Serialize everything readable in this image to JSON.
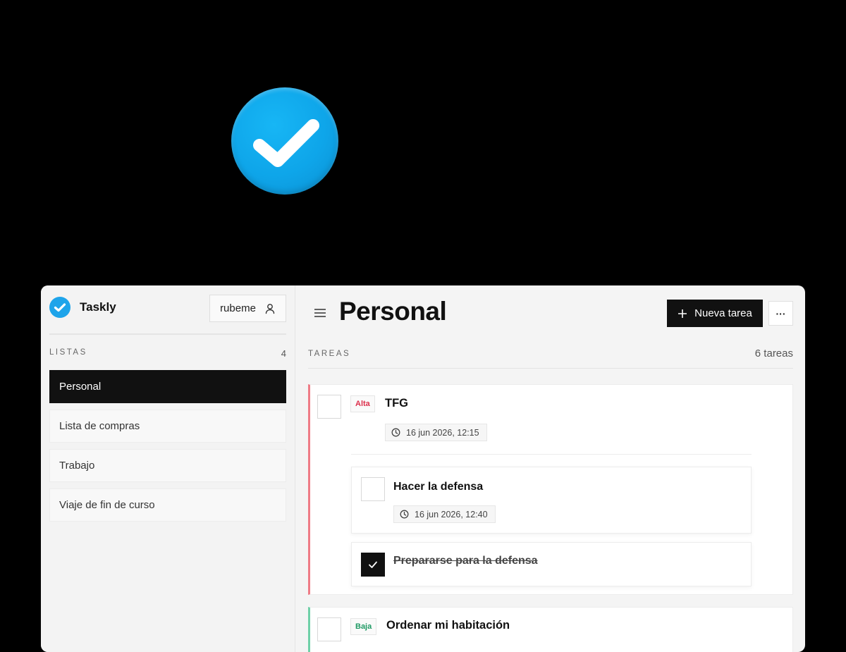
{
  "app": {
    "name": "Taskly",
    "brand_color": "#1ea4ea"
  },
  "user": {
    "name": "rubeme",
    "icon": "user-icon"
  },
  "sidebar": {
    "lists_label": "LISTAS",
    "lists_count": "4",
    "items": [
      {
        "label": "Personal",
        "active": true
      },
      {
        "label": "Lista de compras",
        "active": false
      },
      {
        "label": "Trabajo",
        "active": false
      },
      {
        "label": "Viaje de fin de curso",
        "active": false
      }
    ]
  },
  "header": {
    "title": "Personal",
    "new_task_label": "Nueva tarea",
    "more_label": "···"
  },
  "tasks_section": {
    "label": "TAREAS",
    "count": "6 tareas"
  },
  "tasks": [
    {
      "title": "TFG",
      "priority": "Alta",
      "priority_color": "#dc2f4b",
      "date": "16 jun 2026, 12:15",
      "completed": false,
      "subtasks": [
        {
          "title": "Hacer la defensa",
          "date": "16 jun 2026, 12:40",
          "completed": false
        },
        {
          "title": "Prepararse para la defensa",
          "completed": true
        }
      ]
    },
    {
      "title": "Ordenar mi habitación",
      "priority": "Baja",
      "priority_color": "#1f9a64",
      "completed": false
    }
  ]
}
